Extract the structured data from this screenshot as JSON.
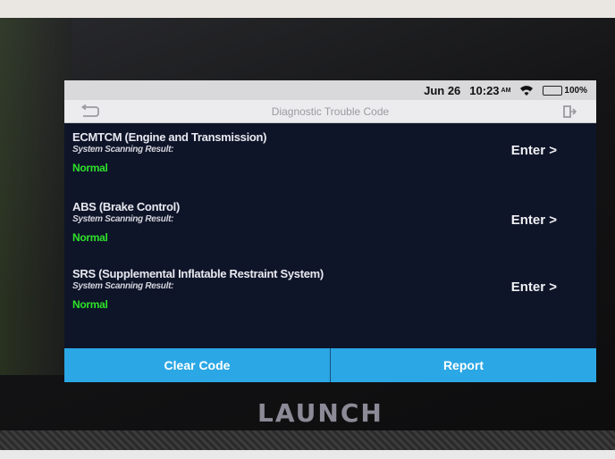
{
  "status": {
    "date": "Jun 26",
    "time": "10:23",
    "ampm": "AM",
    "battery": "100%",
    "battery_level": 1.0
  },
  "header": {
    "title": "Diagnostic Trouble Code",
    "back_icon": "back-arrow-icon",
    "exit_icon": "exit-icon"
  },
  "systems": [
    {
      "name": "ECMTCM (Engine and Transmission)",
      "scan_label": "System Scanning Result:",
      "result": "Normal",
      "enter": "Enter >"
    },
    {
      "name": "ABS (Brake Control)",
      "scan_label": "System Scanning Result:",
      "result": "Normal",
      "enter": "Enter >"
    },
    {
      "name": "SRS (Supplemental Inflatable Restraint System)",
      "scan_label": "System Scanning Result:",
      "result": "Normal",
      "enter": "Enter >"
    }
  ],
  "actions": {
    "clear_code": "Clear Code",
    "report": "Report"
  },
  "device": {
    "brand": "LAUNCH"
  },
  "colors": {
    "screen_bg": "#0f1529",
    "result_ok": "#2ee12a",
    "action_bar": "#2ba7e5",
    "battery_fill": "#22c02e"
  }
}
